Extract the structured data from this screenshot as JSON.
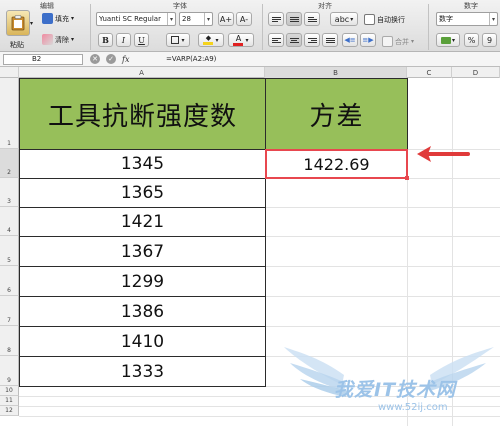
{
  "ribbon": {
    "groups": {
      "edit": "编辑",
      "font": "字体",
      "align": "对齐",
      "number": "数字"
    },
    "paste_label": "粘贴",
    "fill_label": "填充",
    "clear_label": "清除",
    "font_name": "Yuanti SC Regular",
    "font_size": "28",
    "increase_font": "A+",
    "decrease_font": "A-",
    "bold": "B",
    "italic": "I",
    "underline": "U",
    "font_color_glyph": "A",
    "orientation_label": "abc",
    "wrap_label": "自动换行",
    "merge_label": "合并",
    "number_format": "数字",
    "percent_glyph": "%",
    "comma_glyph": "9",
    "accent_colors": {
      "fill": "#f5d31c",
      "font": "#e02020"
    }
  },
  "formula_bar": {
    "name_box": "B2",
    "cancel_glyph": "✕",
    "enter_glyph": "✓",
    "fx_label": "fx",
    "formula": "=VARP(A2:A9)"
  },
  "sheet": {
    "column_headers": [
      "A",
      "B",
      "C",
      "D"
    ],
    "row_headers": [
      "1",
      "2",
      "3",
      "4",
      "5",
      "6",
      "7",
      "8",
      "9",
      "10",
      "11",
      "12"
    ],
    "header_a": "工具抗断强度数",
    "header_b": "方差",
    "values": [
      "1345",
      "1365",
      "1421",
      "1367",
      "1299",
      "1386",
      "1410",
      "1333"
    ],
    "result": "1422.69",
    "header_fill": "#97bf5a",
    "selection_color": "#e8474f"
  },
  "watermark": {
    "text": "我爱IT技术网",
    "url": "www.52ij.com"
  }
}
